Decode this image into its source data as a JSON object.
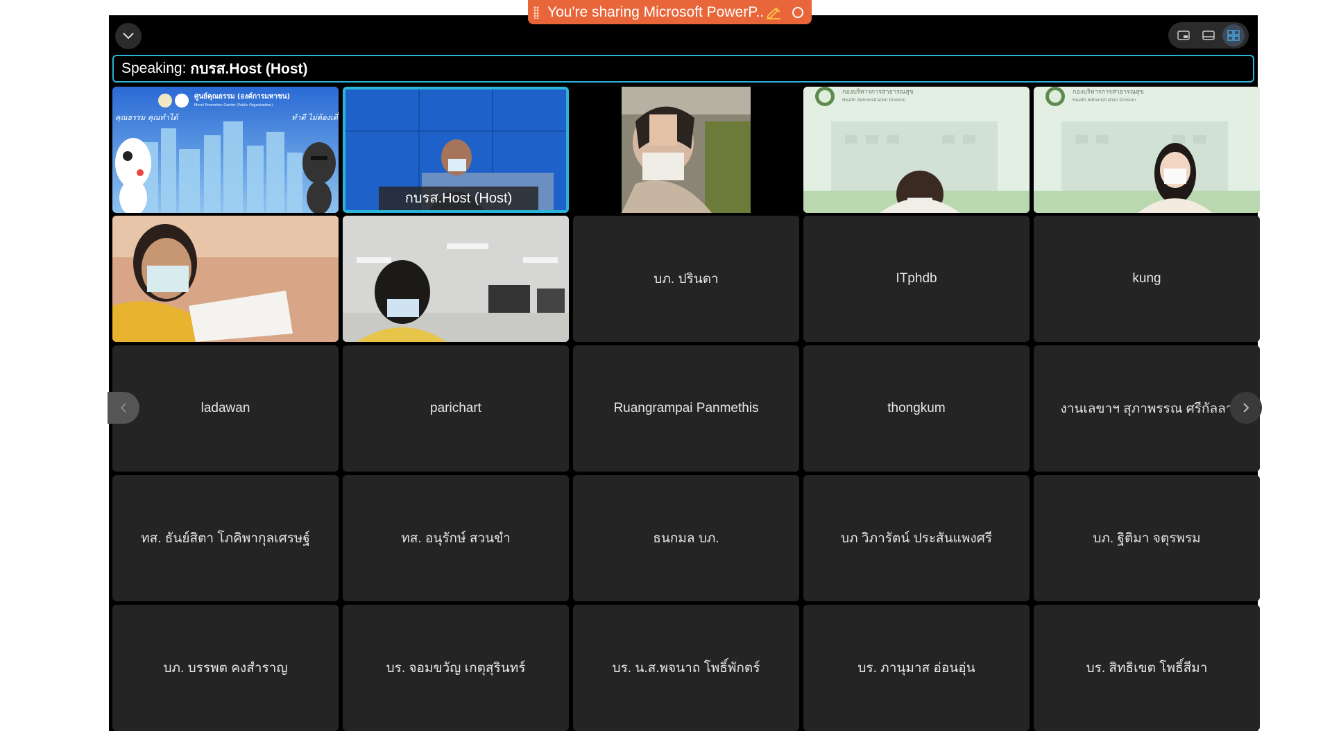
{
  "banner": {
    "text": "You're sharing Microsoft PowerP..."
  },
  "speaking": {
    "label": "Speaking:",
    "name": "กบรส.Host (Host)"
  },
  "layout_options": [
    "floating-view",
    "speaker-view",
    "gallery-view"
  ],
  "active_layout": "gallery-view",
  "video_tiles": {
    "host_tag": "กบรส.Host  (Host)"
  },
  "participants": [
    "บภ. ปรินดา",
    "ITphdb",
    "kung",
    "ladawan",
    "parichart",
    "Ruangrampai Panmethis",
    "thongkum",
    "งานเลขาฯ สุภาพรรณ ศรีกัลลา",
    "ทส. ธันย์สิตา โภคิพากุลเศรษฐ์",
    "ทส. อนุรักษ์ สวนขำ",
    "ธนกมล บภ.",
    "บภ วิภารัตน์ ประสันแพงศรี",
    "บภ. ฐิติมา จตุรพรม",
    "บภ. บรรพต คงสำราญ",
    "บร. จอมขวัญ เกตุสุรินทร์",
    "บร. น.ส.พจนาถ โพธิ์พักตร์",
    "บร. ภานุมาส อ่อนอุ่น",
    "บร. สิทธิเขต โพธิ์สีมา"
  ],
  "poster": {
    "org": "ศูนย์คุณธรรม (องค์การมหาชน)",
    "org_en": "Moral Promotion Center (Public Organization)",
    "left_text": "คุณธรรม คุณทำได้",
    "right_text": "ทำดี ไม่ต้องเดี๋ยว"
  },
  "hospital_logo_text": "กองบริหารการสาธารณสุข",
  "hospital_logo_en": "Health Administration Division",
  "colors": {
    "accent": "#2bb3d8",
    "banner": "#e8663a",
    "tile": "#242424"
  }
}
